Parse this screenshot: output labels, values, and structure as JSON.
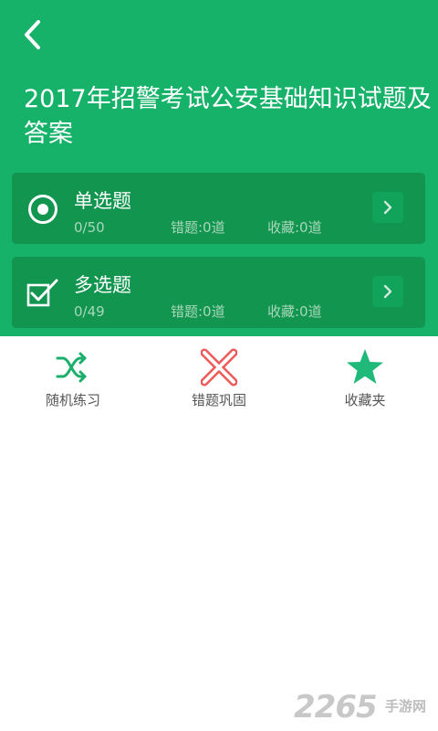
{
  "header": {
    "title": "2017年招警考试公安基础知识试题及答案",
    "background_color": "#17b26a"
  },
  "cards": [
    {
      "title": "单选题",
      "progress": "0/50",
      "wrong": "错题:0道",
      "favorites": "收藏:0道",
      "icon": "radio-target-icon"
    },
    {
      "title": "多选题",
      "progress": "0/49",
      "wrong": "错题:0道",
      "favorites": "收藏:0道",
      "icon": "checkbox-icon"
    }
  ],
  "actions": [
    {
      "label": "随机练习",
      "icon": "shuffle-icon",
      "color": "#1ab06c"
    },
    {
      "label": "错题巩固",
      "icon": "cross-icon",
      "color": "#ef5858"
    },
    {
      "label": "收藏夹",
      "icon": "star-icon",
      "color": "#1fb97a"
    }
  ],
  "watermark": {
    "number": "2265",
    "text": "手游网"
  }
}
